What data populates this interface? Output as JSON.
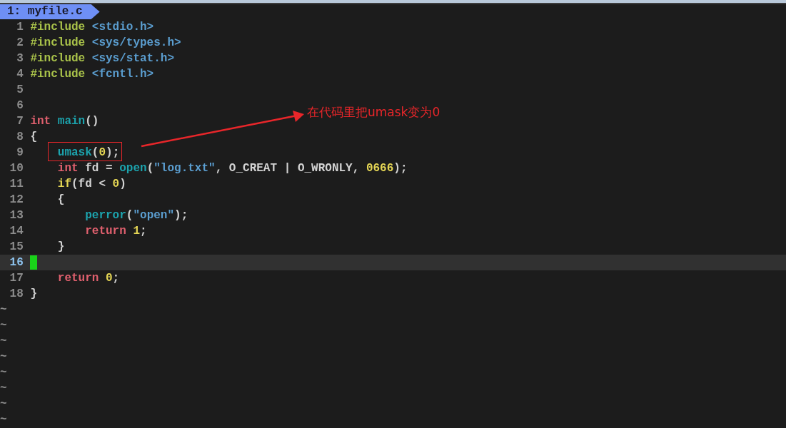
{
  "tab": {
    "label": "1: myfile.c",
    "selected": true
  },
  "lines": [
    {
      "number": "1",
      "current": false,
      "boxed": false,
      "tokens": [
        {
          "kind": "preproc",
          "text": "#include"
        },
        {
          "kind": "path",
          "text": " <stdio.h>"
        }
      ]
    },
    {
      "number": "2",
      "current": false,
      "boxed": false,
      "tokens": [
        {
          "kind": "preproc",
          "text": "#include"
        },
        {
          "kind": "path",
          "text": " <sys/types.h>"
        }
      ]
    },
    {
      "number": "3",
      "current": false,
      "boxed": false,
      "tokens": [
        {
          "kind": "preproc",
          "text": "#include"
        },
        {
          "kind": "path",
          "text": " <sys/stat.h>"
        }
      ]
    },
    {
      "number": "4",
      "current": false,
      "boxed": false,
      "tokens": [
        {
          "kind": "preproc",
          "text": "#include"
        },
        {
          "kind": "path",
          "text": " <fcntl.h>"
        }
      ]
    },
    {
      "number": "5",
      "current": false,
      "boxed": false
    },
    {
      "number": "6",
      "current": false,
      "boxed": false
    },
    {
      "number": "7",
      "current": false,
      "boxed": false,
      "tokens": [
        {
          "kind": "type",
          "text": "int"
        },
        {
          "kind": "func",
          "text": " main"
        },
        {
          "kind": "plain",
          "text": "()"
        }
      ]
    },
    {
      "number": "8",
      "current": false,
      "boxed": false,
      "tokens": [
        {
          "kind": "plain",
          "text": "{"
        }
      ]
    },
    {
      "number": "9",
      "current": false,
      "boxed": true,
      "tokens": [
        {
          "kind": "func",
          "text": "    umask"
        },
        {
          "kind": "plain",
          "text": "("
        },
        {
          "kind": "number",
          "text": "0"
        },
        {
          "kind": "plain",
          "text": ");"
        }
      ]
    },
    {
      "number": "10",
      "current": false,
      "boxed": false,
      "tokens": [
        {
          "kind": "type",
          "text": "    int"
        },
        {
          "kind": "plain",
          "text": " fd = "
        },
        {
          "kind": "func",
          "text": "open"
        },
        {
          "kind": "plain",
          "text": "("
        },
        {
          "kind": "string",
          "text": "\"log.txt\""
        },
        {
          "kind": "plain",
          "text": ", O_CREAT | O_WRONLY, "
        },
        {
          "kind": "number",
          "text": "0666"
        },
        {
          "kind": "plain",
          "text": ");"
        }
      ]
    },
    {
      "number": "11",
      "current": false,
      "boxed": false,
      "tokens": [
        {
          "kind": "cond",
          "text": "    if"
        },
        {
          "kind": "plain",
          "text": "(fd < "
        },
        {
          "kind": "number",
          "text": "0"
        },
        {
          "kind": "plain",
          "text": ")"
        }
      ]
    },
    {
      "number": "12",
      "current": false,
      "boxed": false,
      "tokens": [
        {
          "kind": "plain",
          "text": "    {"
        }
      ]
    },
    {
      "number": "13",
      "current": false,
      "boxed": false,
      "tokens": [
        {
          "kind": "func",
          "text": "        perror"
        },
        {
          "kind": "plain",
          "text": "("
        },
        {
          "kind": "string",
          "text": "\"open\""
        },
        {
          "kind": "plain",
          "text": ");"
        }
      ]
    },
    {
      "number": "14",
      "current": false,
      "boxed": false,
      "tokens": [
        {
          "kind": "type",
          "text": "        return"
        },
        {
          "kind": "number",
          "text": " 1"
        },
        {
          "kind": "plain",
          "text": ";"
        }
      ]
    },
    {
      "number": "15",
      "current": false,
      "boxed": false,
      "tokens": [
        {
          "kind": "plain",
          "text": "    }"
        }
      ]
    },
    {
      "number": "16",
      "current": true,
      "boxed": false
    },
    {
      "number": "17",
      "current": false,
      "boxed": false,
      "tokens": [
        {
          "kind": "type",
          "text": "    return"
        },
        {
          "kind": "number",
          "text": " 0"
        },
        {
          "kind": "plain",
          "text": ";"
        }
      ]
    },
    {
      "number": "18",
      "current": false,
      "boxed": false,
      "tokens": [
        {
          "kind": "plain",
          "text": "}"
        }
      ]
    }
  ],
  "empty_line_markers": [
    "~",
    "~",
    "~",
    "~",
    "~",
    "~",
    "~",
    "~"
  ],
  "annotation": {
    "text": "在代码里把umask变为0"
  }
}
